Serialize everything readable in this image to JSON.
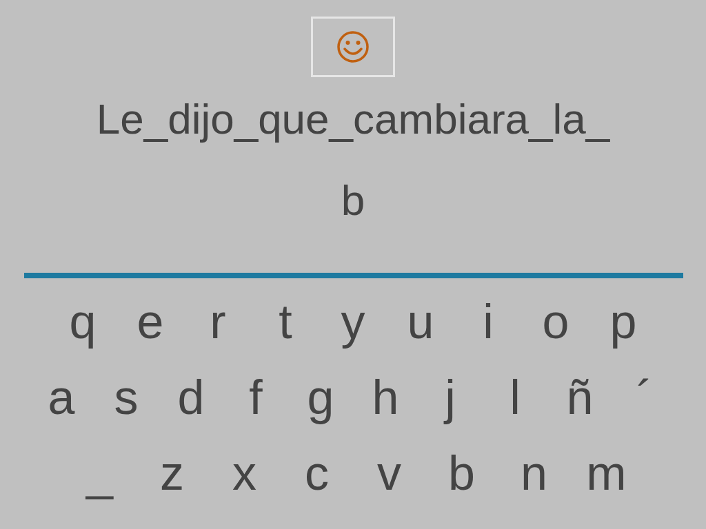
{
  "sentence": "Le_dijo_que_cambiara_la_",
  "answer": "b",
  "keyboard": [
    [
      "q",
      "e",
      "r",
      "t",
      "y",
      "u",
      "i",
      "o",
      "p"
    ],
    [
      "a",
      "s",
      "d",
      "f",
      "g",
      "h",
      "j",
      "l",
      "ñ",
      "´"
    ],
    [
      "_",
      "z",
      "x",
      "c",
      "v",
      "b",
      "n",
      "m"
    ]
  ]
}
